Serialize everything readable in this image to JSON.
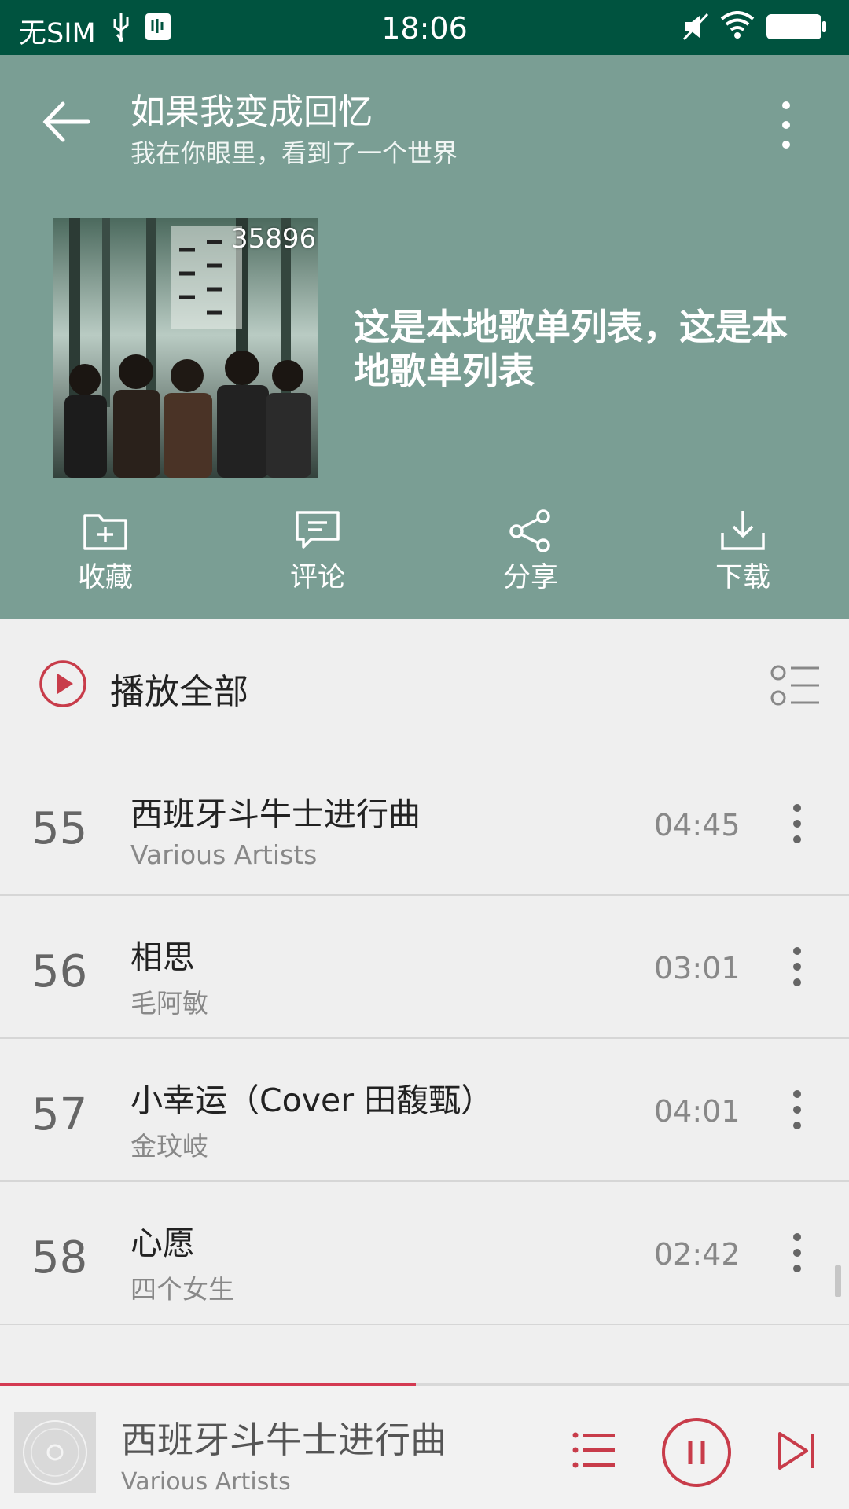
{
  "status_bar": {
    "carrier": "无SIM",
    "time": "18:06"
  },
  "header": {
    "title": "如果我变成回忆",
    "subtitle": "我在你眼里，看到了一个世界",
    "cover_play_count": "35896",
    "playlist_name": "这是本地歌单列表，这是本地歌单列表",
    "actions": [
      {
        "label": "收藏",
        "icon": "folder-add-icon"
      },
      {
        "label": "评论",
        "icon": "comment-icon"
      },
      {
        "label": "分享",
        "icon": "share-icon"
      },
      {
        "label": "下载",
        "icon": "download-icon"
      }
    ],
    "background_color": "#7a9e94"
  },
  "play_all": {
    "label": "播放全部",
    "accent_color": "#c83c4a"
  },
  "songs": [
    {
      "index": "55",
      "title": "西班牙斗牛士进行曲",
      "artist": "Various Artists",
      "duration": "04:45"
    },
    {
      "index": "56",
      "title": "相思",
      "artist": "毛阿敏",
      "duration": "03:01"
    },
    {
      "index": "57",
      "title": "小幸运（Cover 田馥甄）",
      "artist": "金玟岐",
      "duration": "04:01"
    },
    {
      "index": "58",
      "title": "心愿",
      "artist": "四个女生",
      "duration": "02:42"
    }
  ],
  "player": {
    "title": "西班牙斗牛士进行曲",
    "artist": "Various Artists",
    "progress": 0.49,
    "accent_color": "#d43a52"
  }
}
